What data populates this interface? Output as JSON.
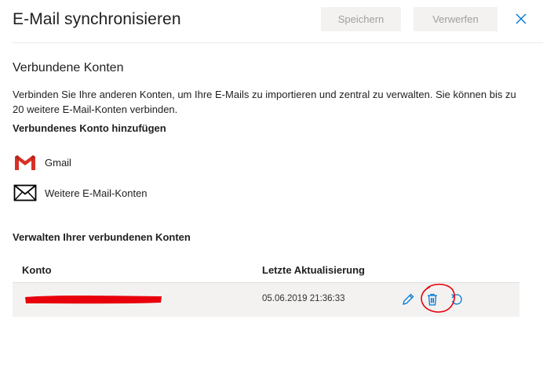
{
  "header": {
    "title": "E-Mail synchronisieren",
    "save_label": "Speichern",
    "discard_label": "Verwerfen",
    "close_icon": "close-icon"
  },
  "connected": {
    "heading": "Verbundene Konten",
    "description": "Verbinden Sie Ihre anderen Konten, um Ihre E-Mails zu importieren und zentral zu verwalten. Sie können bis zu 20 weitere E-Mail-Konten verbinden.",
    "add_heading": "Verbundenes Konto hinzufügen",
    "providers": [
      {
        "label": "Gmail",
        "icon": "gmail-icon"
      },
      {
        "label": "Weitere E-Mail-Konten",
        "icon": "envelope-icon"
      }
    ]
  },
  "manage": {
    "heading": "Verwalten Ihrer verbundenen Konten",
    "columns": [
      "Konto",
      "Letzte Aktualisierung"
    ],
    "rows": [
      {
        "account": "",
        "last_update": "05.06.2019 21:36:33",
        "actions": [
          "pencil-icon",
          "trash-icon",
          "sync-icon"
        ]
      }
    ]
  },
  "colors": {
    "accent": "#0078d4",
    "gmail_red": "#d93025",
    "annotation_red": "#e8000b",
    "row_bg": "#f3f2f1"
  }
}
